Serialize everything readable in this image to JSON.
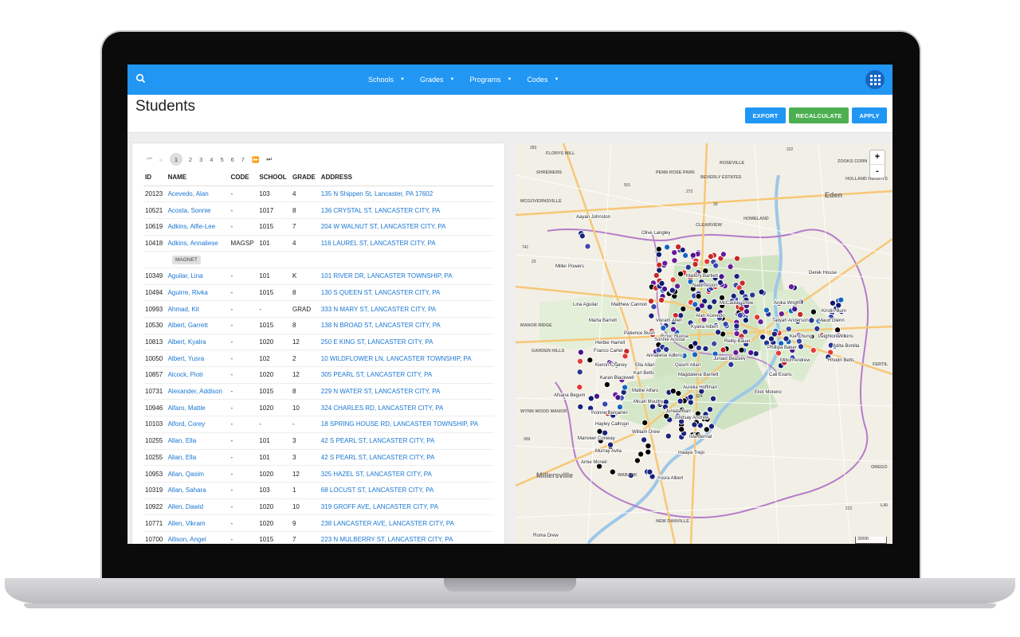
{
  "nav": {
    "items": [
      {
        "label": "Schools"
      },
      {
        "label": "Grades"
      },
      {
        "label": "Programs"
      },
      {
        "label": "Codes"
      }
    ]
  },
  "header": {
    "title": "Students",
    "buttons": {
      "export": "EXPORT",
      "recalculate": "RECALCULATE",
      "apply": "APPLY"
    }
  },
  "pager": {
    "first": "⏮",
    "prev": "«",
    "pages": [
      "1",
      "2",
      "3",
      "4",
      "5",
      "6",
      "7"
    ],
    "current": "1",
    "next": "⏩",
    "last": "⏭"
  },
  "table": {
    "columns": [
      "ID",
      "NAME",
      "CODE",
      "SCHOOL",
      "GRADE",
      "ADDRESS"
    ],
    "rows": [
      {
        "id": "20123",
        "name": "Acevedo, Alan",
        "code": "-",
        "school": "103",
        "grade": "4",
        "address": "135 N Shippen St, Lancaster, PA 17602"
      },
      {
        "id": "10521",
        "name": "Acosta, Sonnie",
        "code": "-",
        "school": "1017",
        "grade": "8",
        "address": "136 CRYSTAL ST, LANCASTER CITY, PA"
      },
      {
        "id": "10619",
        "name": "Adkins, Alfie-Lee",
        "code": "-",
        "school": "1015",
        "grade": "7",
        "address": "204 W WALNUT ST, LANCASTER CITY, PA"
      },
      {
        "id": "10418",
        "name": "Adkins, Annaliese",
        "code": "MAGSP",
        "school": "101",
        "grade": "4",
        "address": "116 LAUREL ST, LANCASTER CITY, PA",
        "tag": "MAGNET"
      },
      {
        "id": "10349",
        "name": "Aguilar, Lina",
        "code": "-",
        "school": "101",
        "grade": "K",
        "address": "101 RIVER DR, LANCASTER TOWNSHIP, PA"
      },
      {
        "id": "10494",
        "name": "Aguirre, Rivka",
        "code": "-",
        "school": "1015",
        "grade": "8",
        "address": "130 S QUEEN ST, LANCASTER CITY, PA"
      },
      {
        "id": "10993",
        "name": "Ahmad, Kit",
        "code": "-",
        "school": "-",
        "grade": "GRAD",
        "address": "333 N MARY ST, LANCASTER CITY, PA"
      },
      {
        "id": "10530",
        "name": "Albert, Garrett",
        "code": "-",
        "school": "1015",
        "grade": "8",
        "address": "138 N BROAD ST, LANCASTER CITY, PA"
      },
      {
        "id": "10813",
        "name": "Albert, Kyalra",
        "code": "-",
        "school": "1020",
        "grade": "12",
        "address": "250 E KING ST, LANCASTER CITY, PA"
      },
      {
        "id": "10050",
        "name": "Albert, Yusra",
        "code": "-",
        "school": "102",
        "grade": "2",
        "address": "10 WILDFLOWER LN, LANCASTER TOWNSHIP, PA"
      },
      {
        "id": "10857",
        "name": "Alcock, Piotr",
        "code": "-",
        "school": "1020",
        "grade": "12",
        "address": "305 PEARL ST, LANCASTER CITY, PA"
      },
      {
        "id": "10731",
        "name": "Alexander, Addison",
        "code": "-",
        "school": "1015",
        "grade": "8",
        "address": "229 N WATER ST, LANCASTER CITY, PA"
      },
      {
        "id": "10946",
        "name": "Alfaro, Mattie",
        "code": "-",
        "school": "1020",
        "grade": "10",
        "address": "324 CHARLES RD, LANCASTER CITY, PA"
      },
      {
        "id": "10103",
        "name": "Alford, Corey",
        "code": "-",
        "school": "-",
        "grade": "-",
        "address": "18 SPRING HOUSE RD, LANCASTER TOWNSHIP, PA"
      },
      {
        "id": "10255",
        "name": "Allan, Ella",
        "code": "-",
        "school": "101",
        "grade": "3",
        "address": "42 S PEARL ST, LANCASTER CITY, PA"
      },
      {
        "id": "10255",
        "name": "Allan, Ella",
        "code": "-",
        "school": "101",
        "grade": "3",
        "address": "42 S PEARL ST, LANCASTER CITY, PA"
      },
      {
        "id": "10953",
        "name": "Allan, Qasim",
        "code": "-",
        "school": "1020",
        "grade": "12",
        "address": "325 HAZEL ST, LANCASTER CITY, PA"
      },
      {
        "id": "10319",
        "name": "Allan, Sahara",
        "code": "-",
        "school": "103",
        "grade": "1",
        "address": "68 LOCUST ST, LANCASTER CITY, PA"
      },
      {
        "id": "10922",
        "name": "Allen, Dawid",
        "code": "-",
        "school": "1020",
        "grade": "10",
        "address": "319 GROFF AVE, LANCASTER CITY, PA"
      },
      {
        "id": "10771",
        "name": "Allen, Vikram",
        "code": "-",
        "school": "1020",
        "grade": "9",
        "address": "238 LANCASTER AVE, LANCASTER CITY, PA"
      },
      {
        "id": "10700",
        "name": "Allison, Angel",
        "code": "-",
        "school": "1015",
        "grade": "7",
        "address": "223 N MULBERRY ST, LANCASTER CITY, PA"
      }
    ]
  },
  "map": {
    "zoom_in": "+",
    "zoom_out": "-",
    "scale": "3000ft",
    "place_labels": [
      "FLORYS MILL",
      "SHREINERS",
      "PENN ROSE PARK",
      "BEVERLY ESTATES",
      "ROSEVILLE",
      "ZOOKS CORN",
      "HOLLAND HEIGHTS",
      "Eden",
      "MCGOVERNSVILLE",
      "HOMELAND",
      "CLEARVIEW",
      "MANOR RIDGE",
      "GARDEN HILLS",
      "WYNN WOOD MANOR",
      "Millersville",
      "WABANK",
      "NEW DANVILLE",
      "FERTIL",
      "OREGO",
      "LAI"
    ],
    "road_numbers": [
      "283",
      "222",
      "501",
      "272",
      "30",
      "741",
      "23",
      "324",
      "999",
      "222"
    ],
    "student_labels": [
      "Aayan Johnston",
      "Olive Langley",
      "Miller Powers",
      "Derek House",
      "Mallory Bartlett",
      "Nabil Alston",
      "Lina Aguilar",
      "Matthew Cannon",
      "McCaulay Drew",
      "Anika Wright",
      "Kirstin Burn",
      "Vikram Allen",
      "Alan Acevedo",
      "Taliyah Anderson",
      "Maud Glenn",
      "Marta Barrett",
      "Kyalra Albert",
      "Patience Bush",
      "Roxie Blaese",
      "Kie Chung",
      "Leighton Wilkins",
      "Herbie Harrell",
      "Sonnie Acosta",
      "Reilly-Bauer",
      "Phillipa Baker",
      "Adita Bonilla",
      "Franco Carter",
      "Annaliese Adkins",
      "Junaid Beasley",
      "Milton Andrew",
      "Rhodri Betts",
      "Kieron Chaney",
      "Ella Allan",
      "Qasim Allan",
      "Karl Betts",
      "Karan Blackwell",
      "Magdalena Barnett",
      "Cali Evans",
      "Aurelia Hoffman",
      "Eliot Moreno",
      "Mattie Alfaro",
      "Afsana Begum",
      "Micah Moultry",
      "Yvonne Benjamin",
      "Juniata Barr",
      "Hayley Calhoun",
      "Lindsay Andrew",
      "William Drew",
      "Manveer Conway",
      "Isla Bernal",
      "Murray Avila",
      "Inaaya Trejo",
      "Amie Mcneil",
      "Yusra Albert",
      "Roma Drew"
    ]
  }
}
